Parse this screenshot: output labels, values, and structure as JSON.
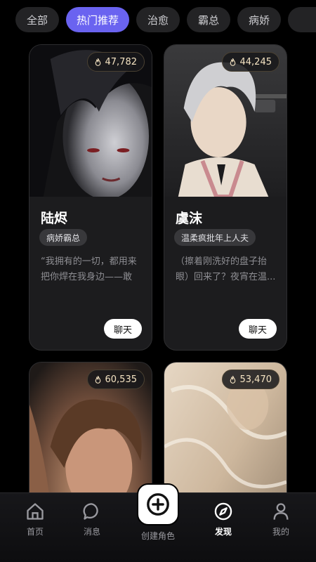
{
  "tabs": [
    {
      "label": "全部",
      "active": false
    },
    {
      "label": "热门推荐",
      "active": true
    },
    {
      "label": "治愈",
      "active": false
    },
    {
      "label": "霸总",
      "active": false
    },
    {
      "label": "病娇",
      "active": false
    }
  ],
  "cards": [
    {
      "heat": "47,782",
      "name": "陆烬",
      "tag": "病娇霸总",
      "quote": "“我拥有的一切，都用来把你焊在我身边——敢走...",
      "button": "聊天"
    },
    {
      "heat": "44,245",
      "name": "虞沫",
      "tag": "温柔疯批年上人夫",
      "quote": "（擦着刚洗好的盘子抬眼）回来了？夜宵在温...",
      "button": "聊天"
    },
    {
      "heat": "60,535"
    },
    {
      "heat": "53,470"
    }
  ],
  "nav": {
    "home": "首页",
    "messages": "消息",
    "create": "创建角色",
    "discover": "发现",
    "mine": "我的"
  },
  "colors": {
    "accent": "#6a63f0",
    "card_bg": "#1c1c1e",
    "heat_text": "#f4e3c2"
  },
  "icons": {
    "heat": "flame-icon",
    "home": "home-icon",
    "messages": "chat-bubble-icon",
    "create": "plus-icon",
    "discover": "compass-icon",
    "mine": "user-icon"
  }
}
